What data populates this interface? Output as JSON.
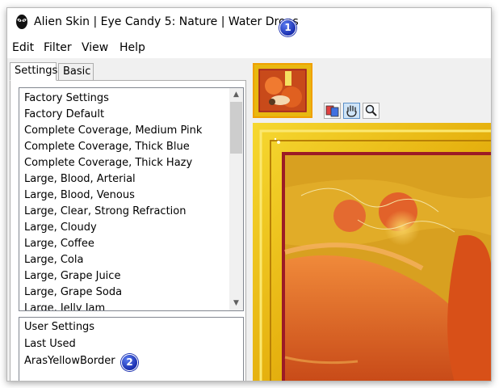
{
  "window": {
    "title": "Alien Skin | Eye Candy 5: Nature | Water Drops",
    "app_icon": "alien-skin-icon"
  },
  "menu": [
    "Edit",
    "Filter",
    "View",
    "Help"
  ],
  "tabs": {
    "settings": "Settings",
    "basic": "Basic"
  },
  "factory_settings": {
    "items": [
      "Factory Settings",
      "Factory Default",
      "Complete Coverage, Medium Pink",
      "Complete Coverage, Thick Blue",
      "Complete Coverage, Thick Hazy",
      "Large, Blood, Arterial",
      "Large, Blood, Venous",
      "Large, Clear, Strong Refraction",
      "Large, Cloudy",
      "Large, Coffee",
      "Large, Cola",
      "Large, Grape Juice",
      "Large, Grape Soda",
      "Large, Jelly Jam"
    ]
  },
  "user_settings": {
    "items": [
      "User Settings",
      "Last Used",
      "ArasYellowBorder"
    ]
  },
  "annotations": {
    "badge_1": "1",
    "badge_2": "2"
  },
  "tools": [
    "preview-compare-icon",
    "hand-pan-icon",
    "zoom-magnifier-icon"
  ],
  "colors": {
    "badge": "#1a2fb0",
    "thumb_border": "#f0a000",
    "preview_frame": "#e8b810",
    "preview_inner_border": "#9c1b25"
  }
}
